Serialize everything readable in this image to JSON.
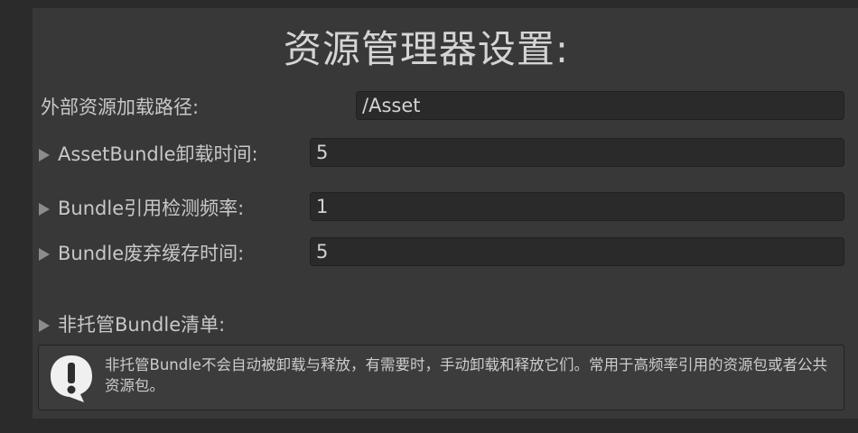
{
  "title": "资源管理器设置:",
  "external_path": {
    "label": "外部资源加载路径:",
    "value": "/Asset"
  },
  "fields": [
    {
      "label": "AssetBundle卸载时间:",
      "value": "5"
    },
    {
      "label": "Bundle引用检测频率:",
      "value": "1"
    },
    {
      "label": "Bundle废弃缓存时间:",
      "value": "5"
    }
  ],
  "unmanaged": {
    "label": "非托管Bundle清单:"
  },
  "help": {
    "icon": "warning-icon",
    "text": "非托管Bundle不会自动被卸载与释放，有需要时，手动卸载和释放它们。常用于高频率引用的资源包或者公共资源包。"
  }
}
